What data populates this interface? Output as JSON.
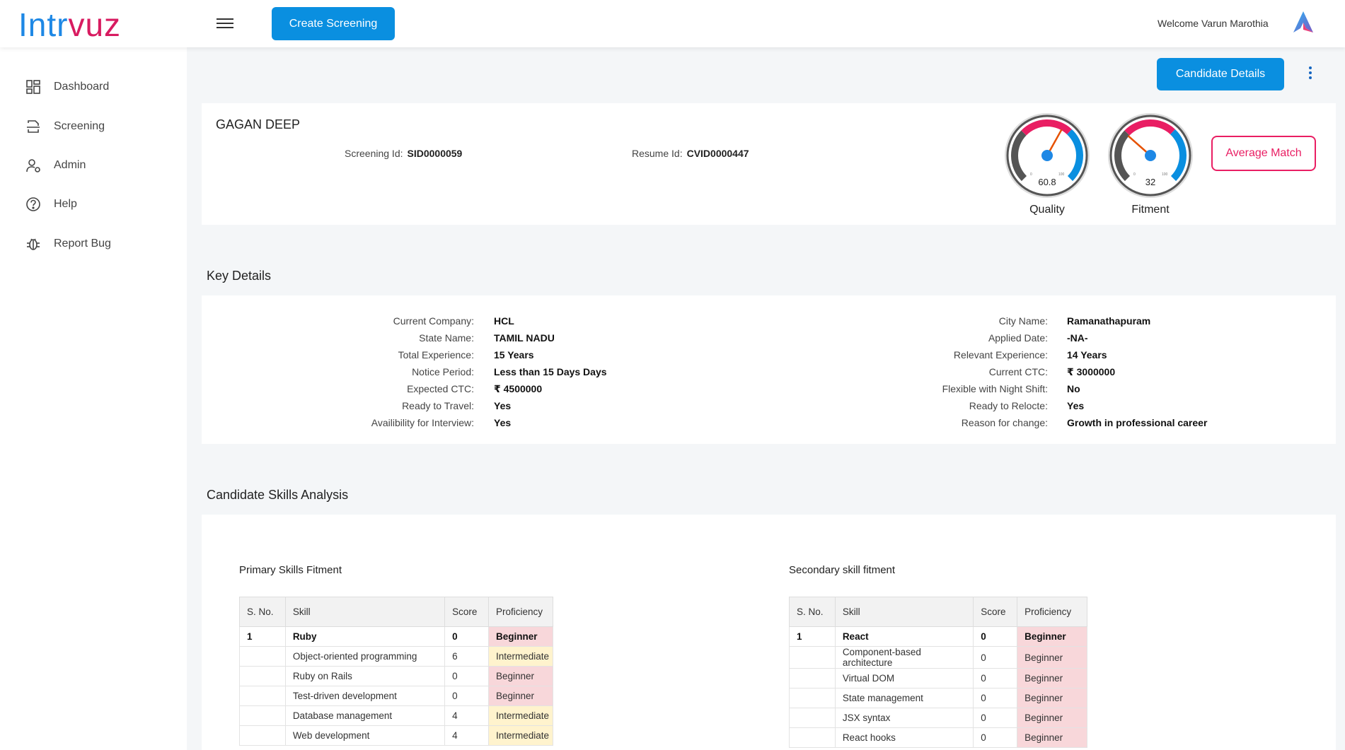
{
  "header": {
    "logo_part1": "Intr",
    "logo_part2": "vuz",
    "create_button": "Create Screening",
    "welcome": "Welcome Varun Marothia"
  },
  "sidebar": {
    "items": [
      {
        "label": "Dashboard",
        "icon": "dashboard-icon"
      },
      {
        "label": "Screening",
        "icon": "screening-icon"
      },
      {
        "label": "Admin",
        "icon": "admin-icon"
      },
      {
        "label": "Help",
        "icon": "help-icon"
      },
      {
        "label": "Report Bug",
        "icon": "bug-icon"
      }
    ]
  },
  "candidate": {
    "details_button": "Candidate Details",
    "name": "GAGAN DEEP",
    "screening_id_label": "Screening Id:",
    "screening_id": "SID0000059",
    "resume_id_label": "Resume Id:",
    "resume_id": "CVID0000447",
    "quality": {
      "label": "Quality",
      "value": "60.8",
      "fraction": 0.608
    },
    "fitment": {
      "label": "Fitment",
      "value": "32",
      "fraction": 0.32
    },
    "gauge_min": "0",
    "gauge_max": "100",
    "match_button": "Average Match"
  },
  "key_details": {
    "title": "Key Details",
    "left": [
      {
        "k": "Current Company:",
        "v": "HCL"
      },
      {
        "k": "State Name:",
        "v": "TAMIL NADU"
      },
      {
        "k": "Total Experience:",
        "v": "15 Years"
      },
      {
        "k": "Notice Period:",
        "v": "Less than 15 Days Days"
      },
      {
        "k": "Expected CTC:",
        "v": "₹ 4500000"
      },
      {
        "k": "Ready to Travel:",
        "v": "Yes"
      },
      {
        "k": "Availibility for Interview:",
        "v": "Yes"
      }
    ],
    "right": [
      {
        "k": "City Name:",
        "v": "Ramanathapuram"
      },
      {
        "k": "Applied Date:",
        "v": "-NA-"
      },
      {
        "k": "Relevant Experience:",
        "v": "14 Years"
      },
      {
        "k": "Current CTC:",
        "v": "₹ 3000000"
      },
      {
        "k": "Flexible with Night Shift:",
        "v": "No"
      },
      {
        "k": "Ready to Relocte:",
        "v": "Yes"
      },
      {
        "k": "Reason for change:",
        "v": "Growth in professional career"
      }
    ]
  },
  "skills": {
    "title": "Candidate Skills Analysis",
    "columns": [
      "S. No.",
      "Skill",
      "Score",
      "Proficiency"
    ],
    "primary": {
      "title": "Primary Skills Fitment",
      "rows": [
        {
          "sno": "1",
          "skill": "Ruby",
          "score": "0",
          "prof": "Beginner"
        },
        {
          "sno": "",
          "skill": "Object-oriented programming",
          "score": "6",
          "prof": "Intermediate"
        },
        {
          "sno": "",
          "skill": "Ruby on Rails",
          "score": "0",
          "prof": "Beginner"
        },
        {
          "sno": "",
          "skill": "Test-driven development",
          "score": "0",
          "prof": "Beginner"
        },
        {
          "sno": "",
          "skill": "Database management",
          "score": "4",
          "prof": "Intermediate"
        },
        {
          "sno": "",
          "skill": "Web development",
          "score": "4",
          "prof": "Intermediate"
        }
      ]
    },
    "secondary": {
      "title": "Secondary skill fitment",
      "rows": [
        {
          "sno": "1",
          "skill": "React",
          "score": "0",
          "prof": "Beginner"
        },
        {
          "sno": "",
          "skill": "Component-based architecture",
          "score": "0",
          "prof": "Beginner"
        },
        {
          "sno": "",
          "skill": "Virtual DOM",
          "score": "0",
          "prof": "Beginner"
        },
        {
          "sno": "",
          "skill": "State management",
          "score": "0",
          "prof": "Beginner"
        },
        {
          "sno": "",
          "skill": "JSX syntax",
          "score": "0",
          "prof": "Beginner"
        },
        {
          "sno": "",
          "skill": "React hooks",
          "score": "0",
          "prof": "Beginner"
        }
      ]
    }
  },
  "colors": {
    "primary": "#0a8fe0",
    "accent": "#e91e63",
    "beginner": "#f8d7da",
    "intermediate": "#fff3cd"
  }
}
